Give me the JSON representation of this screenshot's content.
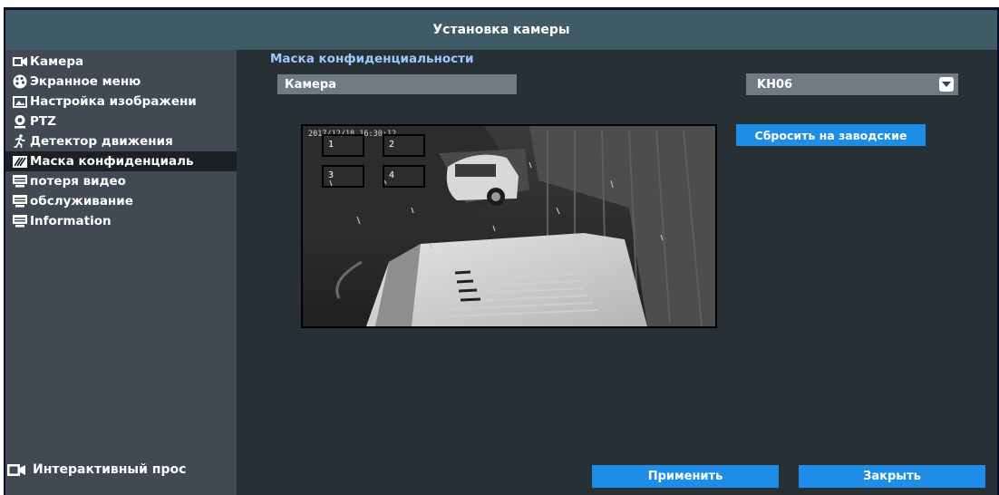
{
  "window": {
    "title": "Установка камеры"
  },
  "sidebar": {
    "items": [
      {
        "label": "Камера",
        "icon": "camera-icon"
      },
      {
        "label": "Экранное меню",
        "icon": "palette-icon"
      },
      {
        "label": "Настройка изображени",
        "icon": "image-icon"
      },
      {
        "label": "PTZ",
        "icon": "ptz-icon"
      },
      {
        "label": "Детектор движения",
        "icon": "running-person-icon"
      },
      {
        "label": "Маска конфиденциаль",
        "icon": "privacy-mask-icon",
        "active": true
      },
      {
        "label": "потеря видео",
        "icon": "monitor-icon"
      },
      {
        "label": "обслуживание",
        "icon": "monitor-icon"
      },
      {
        "label": "Information",
        "icon": "monitor-icon"
      }
    ],
    "live_view": {
      "label": "Интерактивный прос",
      "icon": "camera-icon"
    }
  },
  "main": {
    "section_title": "Маска конфиденциальности",
    "camera_label": "Камера",
    "channel": {
      "value": "KH06"
    },
    "reset_button": "Сбросить на заводские",
    "preview": {
      "timestamp": "2017/12/18 16:30:12",
      "mask_areas": [
        {
          "label": "1"
        },
        {
          "label": "2"
        },
        {
          "label": "3"
        },
        {
          "label": "4"
        }
      ]
    }
  },
  "footer": {
    "apply_button": "Применить",
    "close_button": "Закрыть"
  },
  "colors": {
    "title_bar": "#3f5c66",
    "sidebar_bg": "#414a52",
    "main_bg": "#273034",
    "active_item_bg": "#1c2024",
    "accent_button": "#1e8de8",
    "section_title": "#9cc8ff",
    "field_bg": "#6f7a83"
  }
}
